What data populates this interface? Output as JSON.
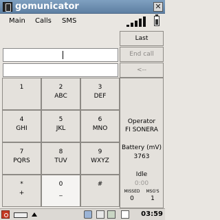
{
  "window": {
    "title": "gomunicator"
  },
  "menu": {
    "items": [
      "Main",
      "Calls",
      "SMS"
    ]
  },
  "number_field": {
    "value": ""
  },
  "info_field": {
    "value": ""
  },
  "side_buttons": {
    "last": "Last",
    "end_call": "End call",
    "backspace": "<--"
  },
  "keypad": [
    {
      "digit": "1",
      "letters": ""
    },
    {
      "digit": "2",
      "letters": "ABC"
    },
    {
      "digit": "3",
      "letters": "DEF"
    },
    {
      "digit": "4",
      "letters": "GHI"
    },
    {
      "digit": "5",
      "letters": "JKL"
    },
    {
      "digit": "6",
      "letters": "MNO"
    },
    {
      "digit": "7",
      "letters": "PQRS"
    },
    {
      "digit": "8",
      "letters": "TUV"
    },
    {
      "digit": "9",
      "letters": "WXYZ"
    },
    {
      "digit": "*",
      "letters": "+"
    },
    {
      "digit": "0",
      "letters": "_"
    },
    {
      "digit": "#",
      "letters": ""
    }
  ],
  "status": {
    "operator_label": "Operator",
    "operator_name": "FI SONERA",
    "battery_label": "Battery (mV)",
    "battery_value": "3763",
    "call_state": "Idle",
    "call_time": "0:00",
    "missed_label": "MISSED",
    "missed_count": "0",
    "msgs_label": "MSG'S",
    "msgs_count": "1"
  },
  "taskbar": {
    "clock": "03:59"
  }
}
